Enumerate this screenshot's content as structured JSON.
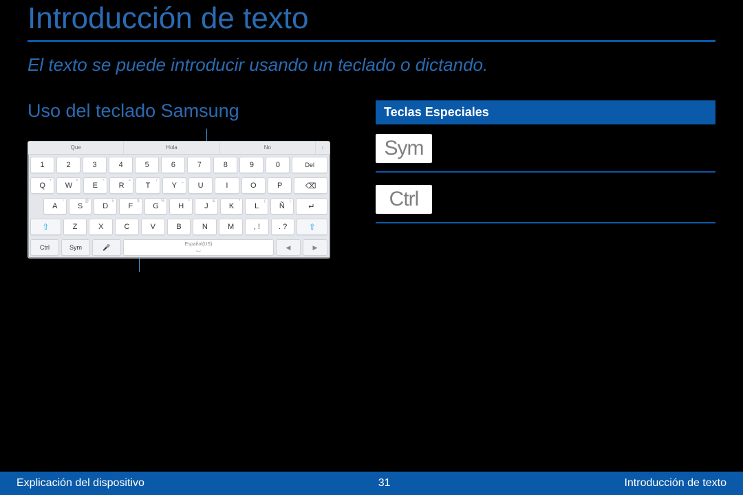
{
  "page": {
    "title": "Introducción de texto",
    "subtitle": "El texto se puede introducir usando un teclado o dictando.",
    "number": "31"
  },
  "left": {
    "heading": "Uso del teclado Samsung",
    "intro_text": "",
    "caption_top_text": "",
    "caption_bottom_text": ""
  },
  "keyboard": {
    "suggestions": [
      "Que",
      "Hola",
      "No"
    ],
    "suggest_more_glyph": "›",
    "row_numbers": [
      "1",
      "2",
      "3",
      "4",
      "5",
      "6",
      "7",
      "8",
      "9",
      "0"
    ],
    "row_numbers_del": "Del",
    "row1": [
      "Q",
      "W",
      "E",
      "R",
      "T",
      "Y",
      "U",
      "I",
      "O",
      "P"
    ],
    "row1_sup": [
      "+",
      "×",
      "÷",
      "=",
      "/",
      "_",
      "",
      "",
      "",
      ""
    ],
    "row2": [
      "A",
      "S",
      "D",
      "F",
      "G",
      "H",
      "J",
      "K",
      "L",
      "Ñ"
    ],
    "row2_sup": [
      "!",
      "@",
      "#",
      "$",
      "%",
      "^",
      "&",
      "*",
      "(",
      ")"
    ],
    "row3": [
      "Z",
      "X",
      "C",
      "V",
      "B",
      "N",
      "M",
      ", !",
      ". ?"
    ],
    "row3_sup": [
      "",
      "",
      "",
      "",
      "",
      "",
      "",
      "",
      ""
    ],
    "ctrl": "Ctrl",
    "sym": "Sym",
    "space_label": "Español(US)",
    "backspace_glyph": "⌫",
    "enter_glyph": "↵",
    "shift_glyph": "⇧",
    "mic_glyph": "🎤",
    "space_glyph": "⌴",
    "arrow_left": "◀",
    "arrow_right": "▶"
  },
  "right": {
    "subheading": "Teclas Especiales",
    "special_keys": [
      {
        "chip": "Sym",
        "desc": ""
      },
      {
        "chip": "Ctrl",
        "desc": ""
      }
    ]
  },
  "footer": {
    "left": "Explicación del dispositivo",
    "right": "Introducción de texto"
  }
}
